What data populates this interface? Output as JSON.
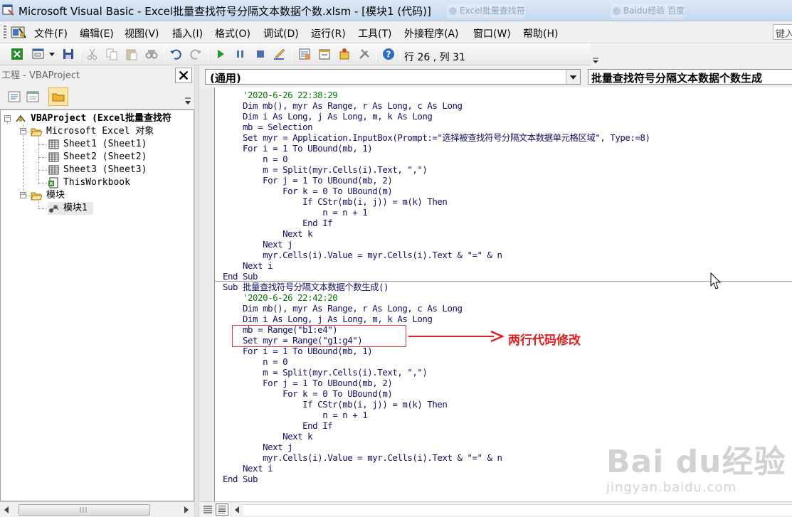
{
  "window": {
    "title": "Microsoft Visual Basic - Excel批量查找符号分隔文本数据个数.xlsm - [模块1 (代码)]",
    "background_tabs": [
      "Excel批量查找符",
      "Baidu经验 百度"
    ]
  },
  "menu": {
    "items": [
      "文件(F)",
      "编辑(E)",
      "视图(V)",
      "插入(I)",
      "格式(O)",
      "调试(D)",
      "运行(R)",
      "工具(T)",
      "外接程序(A)",
      "窗口(W)",
      "帮助(H)"
    ],
    "help_search_placeholder": "键入"
  },
  "toolbar": {
    "cursor_position": "行 26 , 列 31"
  },
  "project": {
    "title": "工程 - VBAProject",
    "tree": {
      "root": "VBAProject (Excel批量查找符",
      "excel_objects_folder": "Microsoft Excel 对象",
      "sheets": [
        "Sheet1 (Sheet1)",
        "Sheet2 (Sheet2)",
        "Sheet3 (Sheet3)"
      ],
      "workbook": "ThisWorkbook",
      "modules_folder": "模块",
      "module": "模块1"
    }
  },
  "code": {
    "object_combo": "(通用)",
    "procedure_combo": "批量查找符号分隔文本数据个数生成",
    "lines": [
      {
        "t": "    '2020-6-26 22:38:29",
        "c": true
      },
      {
        "t": "    Dim mb(), myr As Range, r As Long, c As Long",
        "c": false
      },
      {
        "t": "    Dim i As Long, j As Long, m, k As Long",
        "c": false
      },
      {
        "t": "    mb = Selection",
        "c": false
      },
      {
        "t": "    Set myr = Application.InputBox(Prompt:=\"选择被查找符号分隔文本数据单元格区域\", Type:=8)",
        "c": false
      },
      {
        "t": "    For i = 1 To UBound(mb, 1)",
        "c": false
      },
      {
        "t": "        n = 0",
        "c": false
      },
      {
        "t": "        m = Split(myr.Cells(i).Text, \",\")",
        "c": false
      },
      {
        "t": "        For j = 1 To UBound(mb, 2)",
        "c": false
      },
      {
        "t": "            For k = 0 To UBound(m)",
        "c": false
      },
      {
        "t": "                If CStr(mb(i, j)) = m(k) Then",
        "c": false
      },
      {
        "t": "                    n = n + 1",
        "c": false
      },
      {
        "t": "                End If",
        "c": false
      },
      {
        "t": "            Next k",
        "c": false
      },
      {
        "t": "        Next j",
        "c": false
      },
      {
        "t": "        myr.Cells(i).Value = myr.Cells(i).Text & \"=\" & n",
        "c": false
      },
      {
        "t": "    Next i",
        "c": false
      },
      {
        "t": "End Sub",
        "c": false
      },
      {
        "t": "Sub 批量查找符号分隔文本数据个数生成()",
        "c": false
      },
      {
        "t": "    '2020-6-26 22:42:20",
        "c": true
      },
      {
        "t": "    Dim mb(), myr As Range, r As Long, c As Long",
        "c": false
      },
      {
        "t": "    Dim i As Long, j As Long, m, k As Long",
        "c": false
      },
      {
        "t": "    mb = Range(\"b1:e4\")",
        "c": false
      },
      {
        "t": "    Set myr = Range(\"g1:g4\")",
        "c": false
      },
      {
        "t": "    For i = 1 To UBound(mb, 1)",
        "c": false
      },
      {
        "t": "        n = 0",
        "c": false
      },
      {
        "t": "        m = Split(myr.Cells(i).Text, \",\")",
        "c": false
      },
      {
        "t": "        For j = 1 To UBound(mb, 2)",
        "c": false
      },
      {
        "t": "            For k = 0 To UBound(m)",
        "c": false
      },
      {
        "t": "                If CStr(mb(i, j)) = m(k) Then",
        "c": false
      },
      {
        "t": "                    n = n + 1",
        "c": false
      },
      {
        "t": "                End If",
        "c": false
      },
      {
        "t": "            Next k",
        "c": false
      },
      {
        "t": "        Next j",
        "c": false
      },
      {
        "t": "        myr.Cells(i).Value = myr.Cells(i).Text & \"=\" & n",
        "c": false
      },
      {
        "t": "    Next i",
        "c": false
      },
      {
        "t": "End Sub",
        "c": false
      }
    ]
  },
  "annotation": {
    "text": "两行代码修改"
  },
  "watermark": {
    "logo": "Bai du经验",
    "url": "jingyan.baidu.com"
  },
  "colors": {
    "code_text": "#10106a",
    "comment": "#0a7a0a",
    "annotation": "#e02020"
  }
}
